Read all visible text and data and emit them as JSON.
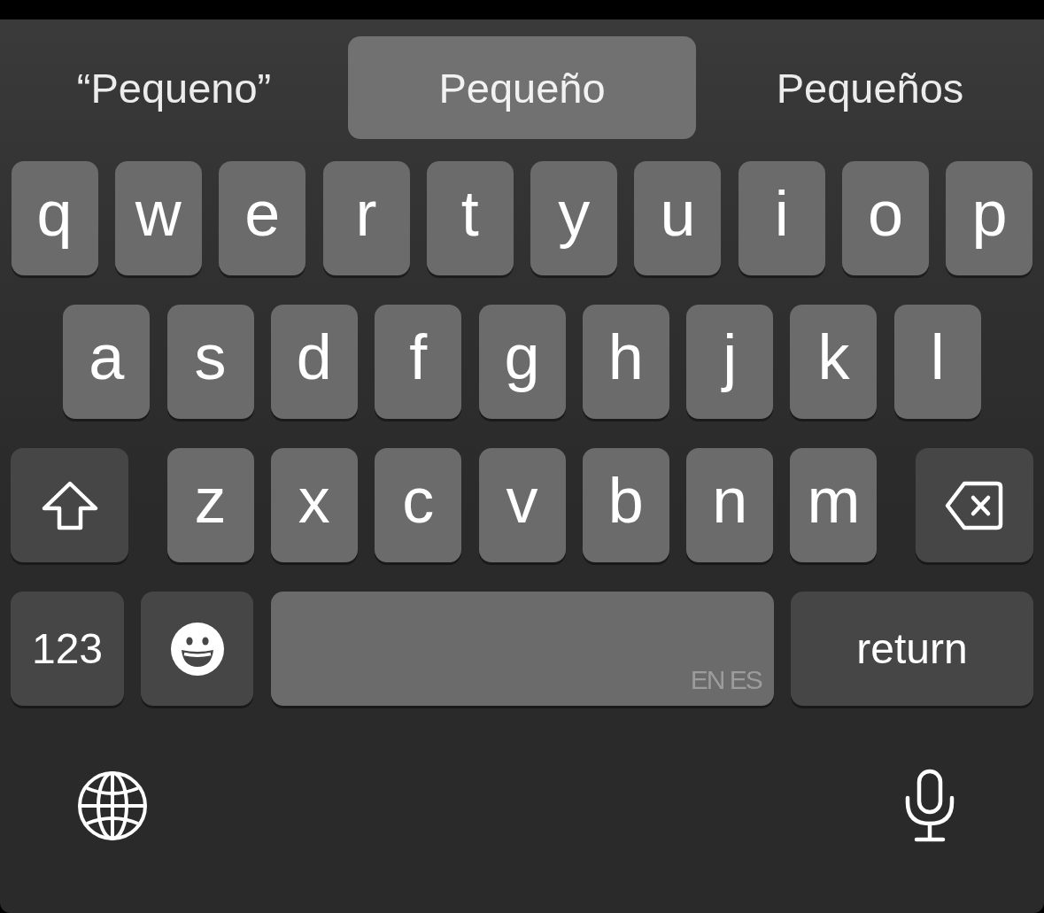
{
  "suggestions": [
    {
      "text": "“Pequeno”",
      "selected": false
    },
    {
      "text": "Pequeño",
      "selected": true
    },
    {
      "text": "Pequeños",
      "selected": false
    }
  ],
  "rows": [
    {
      "keys": [
        {
          "kind": "letter",
          "label": "q"
        },
        {
          "kind": "letter",
          "label": "w"
        },
        {
          "kind": "letter",
          "label": "e"
        },
        {
          "kind": "letter",
          "label": "r"
        },
        {
          "kind": "letter",
          "label": "t"
        },
        {
          "kind": "letter",
          "label": "y"
        },
        {
          "kind": "letter",
          "label": "u"
        },
        {
          "kind": "letter",
          "label": "i"
        },
        {
          "kind": "letter",
          "label": "o"
        },
        {
          "kind": "letter",
          "label": "p"
        }
      ]
    },
    {
      "keys": [
        {
          "kind": "letter",
          "label": "a"
        },
        {
          "kind": "letter",
          "label": "s"
        },
        {
          "kind": "letter",
          "label": "d"
        },
        {
          "kind": "letter",
          "label": "f"
        },
        {
          "kind": "letter",
          "label": "g"
        },
        {
          "kind": "letter",
          "label": "h"
        },
        {
          "kind": "letter",
          "label": "j"
        },
        {
          "kind": "letter",
          "label": "k"
        },
        {
          "kind": "letter",
          "label": "l"
        }
      ]
    },
    {
      "keys": [
        {
          "kind": "shift",
          "on": false
        },
        {
          "kind": "letter",
          "label": "z"
        },
        {
          "kind": "letter",
          "label": "x"
        },
        {
          "kind": "letter",
          "label": "c"
        },
        {
          "kind": "letter",
          "label": "v"
        },
        {
          "kind": "letter",
          "label": "b"
        },
        {
          "kind": "letter",
          "label": "n"
        },
        {
          "kind": "letter",
          "label": "m"
        },
        {
          "kind": "backspace"
        }
      ]
    },
    {
      "keys": [
        {
          "kind": "mode",
          "label": "123"
        },
        {
          "kind": "emoji"
        },
        {
          "kind": "space",
          "hint": "EN ES"
        },
        {
          "kind": "return",
          "label": "return"
        }
      ]
    }
  ]
}
